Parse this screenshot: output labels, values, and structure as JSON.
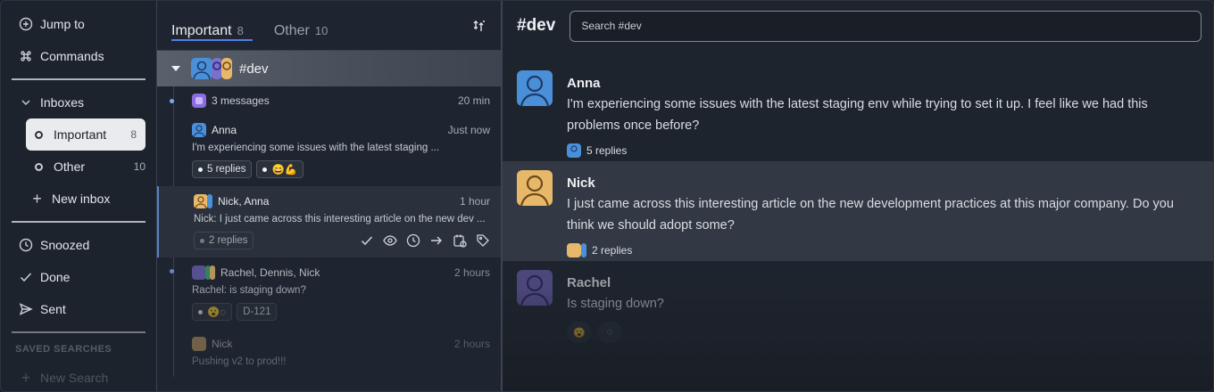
{
  "sidebar": {
    "top": [
      {
        "label": "Jump to",
        "icon": "jump-to-icon"
      },
      {
        "label": "Commands",
        "icon": "command-icon"
      }
    ],
    "inboxes_label": "Inboxes",
    "inboxes": [
      {
        "label": "Important",
        "count": "8"
      },
      {
        "label": "Other",
        "count": "10"
      }
    ],
    "new_inbox": "New inbox",
    "bottom": [
      {
        "label": "Snoozed",
        "icon": "clock-icon"
      },
      {
        "label": "Done",
        "icon": "check-icon"
      },
      {
        "label": "Sent",
        "icon": "send-icon"
      }
    ],
    "saved_heading": "SAVED SEARCHES",
    "new_search": "New Search"
  },
  "list": {
    "tabs": [
      {
        "label": "Important",
        "count": "8"
      },
      {
        "label": "Other",
        "count": "10"
      }
    ],
    "group": {
      "name": "#dev"
    },
    "summary": {
      "label": "3 messages",
      "time": "20 min"
    },
    "items": [
      {
        "who": "Anna",
        "time": "Just now",
        "preview": "I'm experiencing some issues with the latest staging ...",
        "chip": "5 replies",
        "emoji": "😄💪"
      },
      {
        "who": "Nick, Anna",
        "time": "1 hour",
        "preview": "Nick: I just came across this interesting article on the new dev ...",
        "chip": "2 replies"
      },
      {
        "who": "Rachel, Dennis, Nick",
        "time": "2 hours",
        "preview": "Rachel: is staging down?",
        "tag": "D-121"
      },
      {
        "who": "Nick",
        "time": "2 hours",
        "preview": "Pushing v2 to prod!!!"
      }
    ]
  },
  "main": {
    "channel": "#dev",
    "search_placeholder": "Search #dev",
    "messages": [
      {
        "name": "Anna",
        "text": "I'm experiencing some issues with the latest staging env while trying to set it up. I feel like we had this problems once before?",
        "replies": "5 replies"
      },
      {
        "name": "Nick",
        "text": "I just came across this interesting article on the new development practices at this major company. Do you think we should adopt some?",
        "replies": "2 replies"
      },
      {
        "name": "Rachel",
        "text": "Is staging down?"
      }
    ]
  },
  "colors": {
    "anna": "#4a90d9",
    "nick": "#e8b86a",
    "rachel": "#6a5fb0",
    "accent": "#4f7fe6"
  }
}
